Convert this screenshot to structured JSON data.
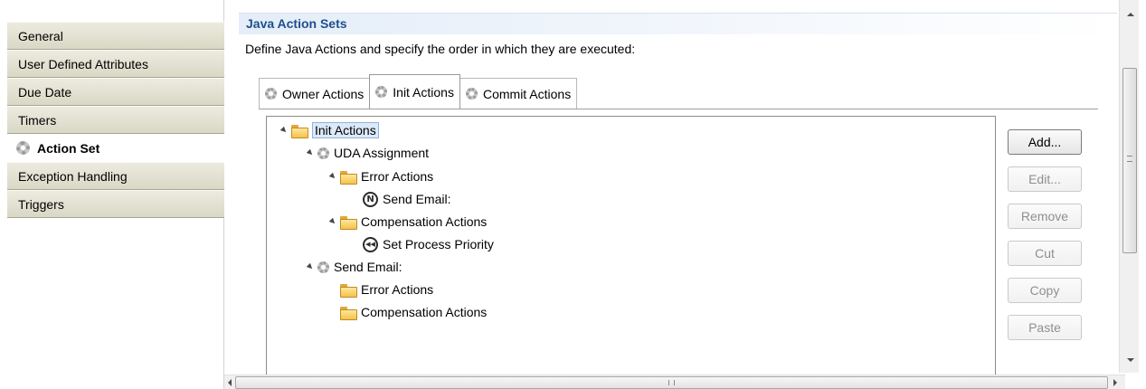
{
  "sidebar": {
    "items": [
      {
        "label": "General",
        "selected": false
      },
      {
        "label": "User Defined Attributes",
        "selected": false
      },
      {
        "label": "Due Date",
        "selected": false
      },
      {
        "label": "Timers",
        "selected": false
      },
      {
        "label": "Action Set",
        "selected": true,
        "icon": "gear-icon"
      },
      {
        "label": "Exception Handling",
        "selected": false
      },
      {
        "label": "Triggers",
        "selected": false
      }
    ]
  },
  "section": {
    "title": "Java Action Sets",
    "description": "Define Java Actions and specify the order in which they are executed:"
  },
  "tabs": [
    {
      "label": "Owner Actions",
      "active": false
    },
    {
      "label": "Init Actions",
      "active": true
    },
    {
      "label": "Commit Actions",
      "active": false
    }
  ],
  "tree": {
    "nodes": [
      {
        "label": "Init Actions",
        "icon": "folder-icon",
        "expanded": true,
        "selected": true
      },
      {
        "label": "UDA Assignment",
        "icon": "gear-icon",
        "expanded": true
      },
      {
        "label": "Error Actions",
        "icon": "folder-icon",
        "expanded": true
      },
      {
        "label": "Send Email:",
        "icon": "email-action-icon"
      },
      {
        "label": "Compensation Actions",
        "icon": "folder-icon",
        "expanded": true
      },
      {
        "label": "Set Process Priority",
        "icon": "priority-action-icon"
      },
      {
        "label": "Send Email:",
        "icon": "gear-icon",
        "expanded": true
      },
      {
        "label": "Error Actions",
        "icon": "folder-icon"
      },
      {
        "label": "Compensation Actions",
        "icon": "folder-icon"
      }
    ]
  },
  "buttons": {
    "add": "Add...",
    "edit": "Edit...",
    "remove": "Remove",
    "cut": "Cut",
    "copy": "Copy",
    "paste": "Paste"
  },
  "icons": {
    "email_action_glyph": "N",
    "priority_action_glyph": "◀◀"
  },
  "colors": {
    "header_text": "#1f4e8c",
    "selection": "#dce9f8"
  }
}
